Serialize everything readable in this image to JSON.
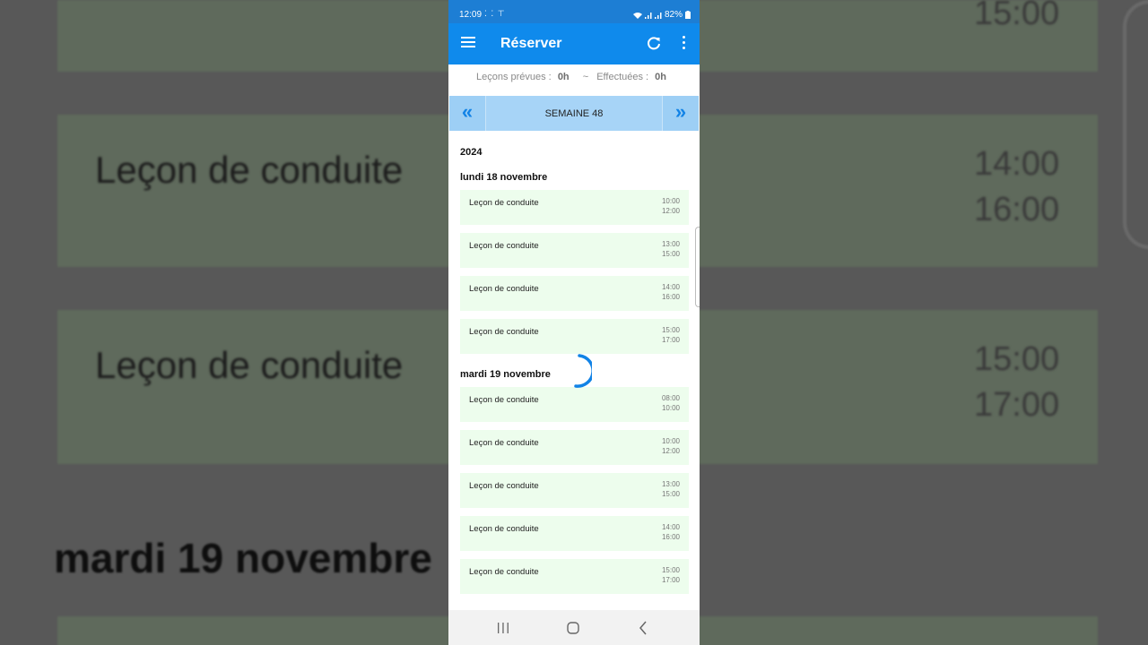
{
  "background": {
    "cards": [
      {
        "label": "Leçon de conduite",
        "start": "14:00",
        "end": "16:00"
      },
      {
        "label": "Leçon de conduite",
        "start": "15:00",
        "end": "17:00"
      }
    ],
    "top_time": "15:00",
    "day_heading": "mardi 19 novembre"
  },
  "statusbar": {
    "time": "12:09",
    "battery": "82%"
  },
  "appbar": {
    "title": "Réserver"
  },
  "summary": {
    "planned_label": "Leçons prévues :",
    "planned_value": "0h",
    "separator": "~",
    "done_label": "Effectuées :",
    "done_value": "0h"
  },
  "week_nav": {
    "prev": "«",
    "label": "SEMAINE 48",
    "next": "»"
  },
  "year": "2024",
  "days": [
    {
      "title": "lundi 18 novembre",
      "lessons": [
        {
          "name": "Leçon de conduite",
          "start": "10:00",
          "end": "12:00"
        },
        {
          "name": "Leçon de conduite",
          "start": "13:00",
          "end": "15:00"
        },
        {
          "name": "Leçon de conduite",
          "start": "14:00",
          "end": "16:00"
        },
        {
          "name": "Leçon de conduite",
          "start": "15:00",
          "end": "17:00"
        }
      ]
    },
    {
      "title": "mardi 19 novembre",
      "lessons": [
        {
          "name": "Leçon de conduite",
          "start": "08:00",
          "end": "10:00"
        },
        {
          "name": "Leçon de conduite",
          "start": "10:00",
          "end": "12:00"
        },
        {
          "name": "Leçon de conduite",
          "start": "13:00",
          "end": "15:00"
        },
        {
          "name": "Leçon de conduite",
          "start": "14:00",
          "end": "16:00"
        },
        {
          "name": "Leçon de conduite",
          "start": "15:00",
          "end": "17:00"
        }
      ]
    }
  ],
  "colors": {
    "appbar": "#0f8aec",
    "statusbar": "#1d7ed4",
    "week_nav": "#a7d4f7",
    "lesson_bg": "#edfded",
    "spinner": "#1283e6"
  },
  "icons": {
    "menu": "hamburger-icon",
    "refresh": "refresh-icon",
    "more": "more-vert-icon",
    "loading": "spinner-icon",
    "nav_recents": "recents-icon",
    "nav_home": "home-icon",
    "nav_back": "back-icon"
  }
}
